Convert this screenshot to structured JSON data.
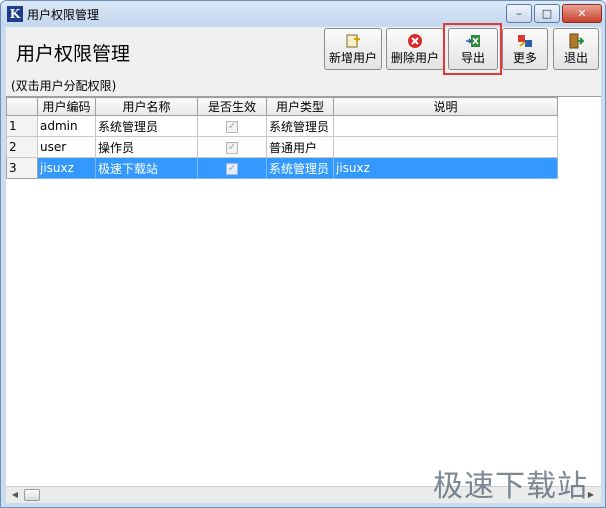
{
  "window": {
    "title": "用户权限管理",
    "app_icon_letter": "K",
    "minimize": "–",
    "maximize": "□",
    "close": "✕"
  },
  "header": {
    "title": "用户权限管理"
  },
  "toolbar": {
    "add_user": "新增用户",
    "delete_user": "删除用户",
    "export": "导出",
    "more": "更多",
    "exit": "退出"
  },
  "hint": "(双击用户分配权限)",
  "table": {
    "columns": [
      "用户编码",
      "用户名称",
      "是否生效",
      "用户类型",
      "说明"
    ],
    "rows": [
      {
        "num": "1",
        "code": "admin",
        "name": "系统管理员",
        "active": true,
        "type": "系统管理员",
        "desc": ""
      },
      {
        "num": "2",
        "code": "user",
        "name": "操作员",
        "active": true,
        "type": "普通用户",
        "desc": ""
      },
      {
        "num": "3",
        "code": "jisuxz",
        "name": "极速下载站",
        "active": true,
        "type": "系统管理员",
        "desc": "jisuxz"
      }
    ],
    "selected_row": 3
  },
  "watermark": "极速下载站",
  "colors": {
    "selection": "#3399ff",
    "highlight_box": "#e23a36"
  }
}
